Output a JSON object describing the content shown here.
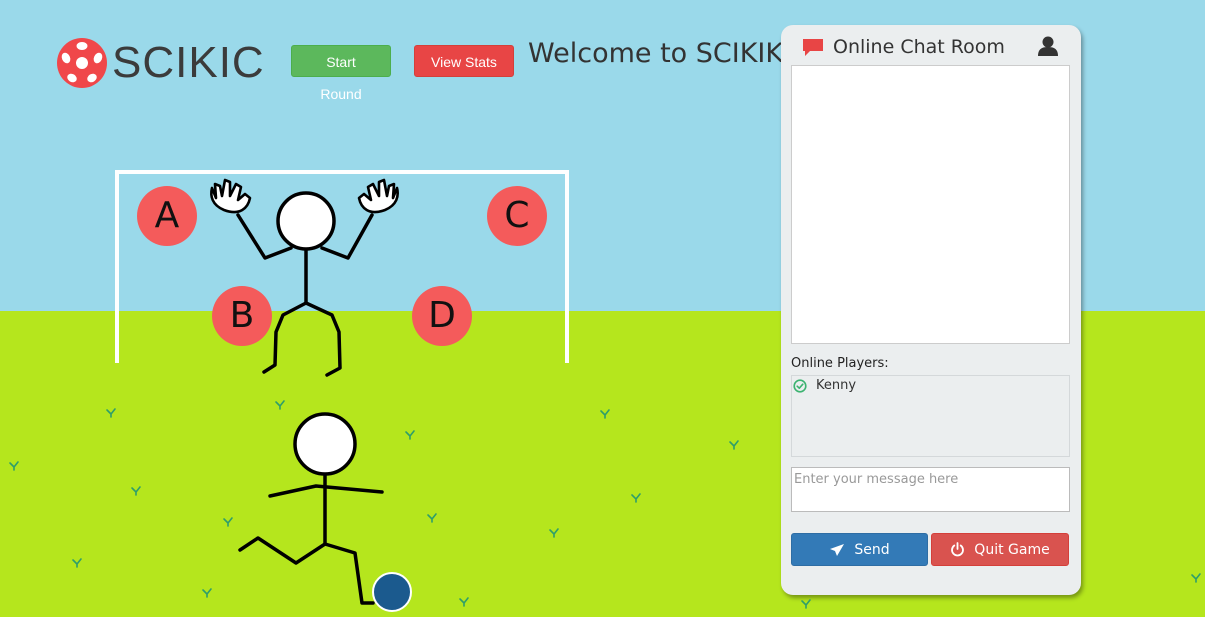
{
  "header": {
    "logo_text": "SCIKIC",
    "start_button": "Start Round",
    "stats_button": "View Stats",
    "welcome": "Welcome to SCIKIK"
  },
  "targets": [
    "A",
    "B",
    "C",
    "D"
  ],
  "chat": {
    "title": "Online Chat Room",
    "players_label": "Online Players:",
    "players": [
      "Kenny"
    ],
    "input_placeholder": "Enter your message here",
    "input_value": "",
    "send_button": "Send",
    "quit_button": "Quit Game"
  },
  "icons": {
    "logo": "soccer-ball-logo-icon",
    "chat": "comment-icon",
    "user": "user-icon",
    "online": "check-circle-icon",
    "send": "paper-plane-icon",
    "quit": "power-icon"
  },
  "colors": {
    "sky": "#9ad9ea",
    "grass": "#b5e61d",
    "target": "#f45b5b",
    "start_button": "#5cb85c",
    "stats_button": "#e84545",
    "send_button": "#337ab7",
    "quit_button": "#d9534f",
    "ball": "#1b5a8e",
    "grass_tufts": "#2e9e6b",
    "online_status": "#3cb371"
  }
}
